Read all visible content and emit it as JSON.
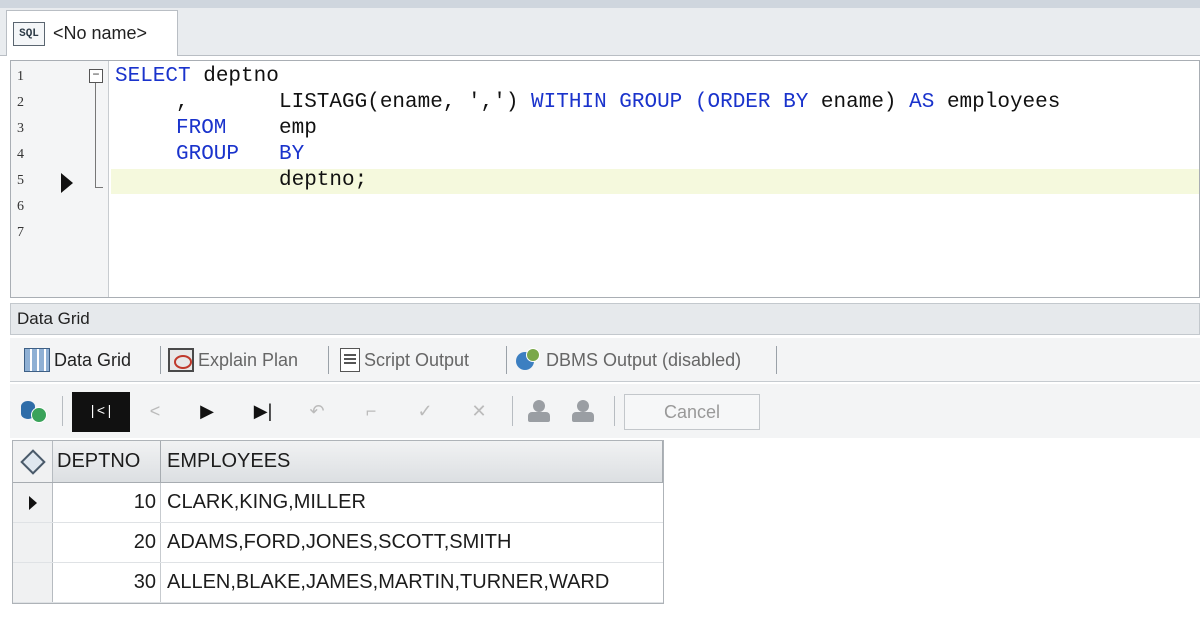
{
  "document_tab": {
    "icon": "sql-file-icon",
    "title": "<No name>"
  },
  "editor": {
    "line_numbers": [
      "1",
      "2",
      "3",
      "4",
      "5",
      "6",
      "7"
    ],
    "current_line": 5,
    "code": {
      "line1_kw": "SELECT",
      "line1_rest": " deptno",
      "line2_comma": ",",
      "line2_fn": "LISTAGG(ename, ',')",
      "line2_kw1": " WITHIN GROUP (ORDER BY",
      "line2_mid": " ename)",
      "line2_kw2": " AS",
      "line2_rest": " employees",
      "line3_kw": "FROM",
      "line3_rest": "emp",
      "line4_kw1": "GROUP",
      "line4_kw2": "BY",
      "line5_rest": "deptno;"
    }
  },
  "panel": {
    "title": "Data Grid"
  },
  "output_tabs": [
    {
      "label": "Data Grid",
      "icon": "data-grid-icon",
      "active": true
    },
    {
      "label": "Explain Plan",
      "icon": "explain-plan-icon",
      "active": false
    },
    {
      "label": "Script Output",
      "icon": "script-output-icon",
      "active": false
    },
    {
      "label": "DBMS Output (disabled)",
      "icon": "dbms-output-icon",
      "active": false
    }
  ],
  "toolbar": {
    "first_record_icon": "first-record-icon",
    "prev_icon": "previous-record-icon",
    "next_icon": "next-record-icon",
    "last_icon": "last-record-icon",
    "cancel_label": "Cancel"
  },
  "result_grid": {
    "columns": [
      "DEPTNO",
      "EMPLOYEES"
    ],
    "rows": [
      {
        "deptno": "10",
        "employees": "CLARK,KING,MILLER"
      },
      {
        "deptno": "20",
        "employees": "ADAMS,FORD,JONES,SCOTT,SMITH"
      },
      {
        "deptno": "30",
        "employees": "ALLEN,BLAKE,JAMES,MARTIN,TURNER,WARD"
      }
    ],
    "selected_row": 0
  },
  "colors": {
    "keyword": "#1a33cc",
    "current_line": "#f5f9dd"
  }
}
